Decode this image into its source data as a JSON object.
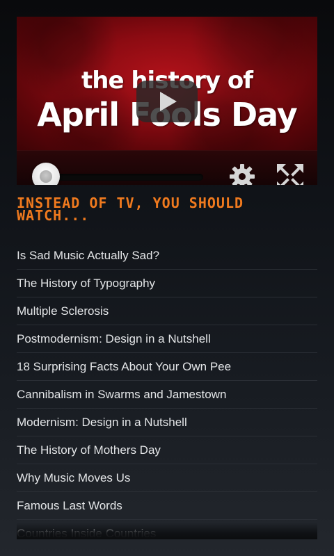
{
  "video": {
    "thumbnail_title_line1": "the history of",
    "thumbnail_title_line2": "April Fools Day",
    "progress": 0,
    "thumbnail_color": "#a01018",
    "play_icon": "play-icon",
    "settings_icon": "gear-icon",
    "fullscreen_icon": "fullscreen-icon"
  },
  "heading": "INSTEAD OF TV, YOU SHOULD WATCH...",
  "accent_color": "#f07a1e",
  "videos": [
    "Is Sad Music Actually Sad?",
    "The History of Typography",
    "Multiple Sclerosis",
    "Postmodernism: Design in a Nutshell",
    "18 Surprising Facts About Your Own Pee",
    "Cannibalism in Swarms and Jamestown",
    "Modernism: Design in a Nutshell",
    "The History of Mothers Day",
    "Why Music Moves Us",
    "Famous Last Words",
    "Countries Inside Countries"
  ]
}
